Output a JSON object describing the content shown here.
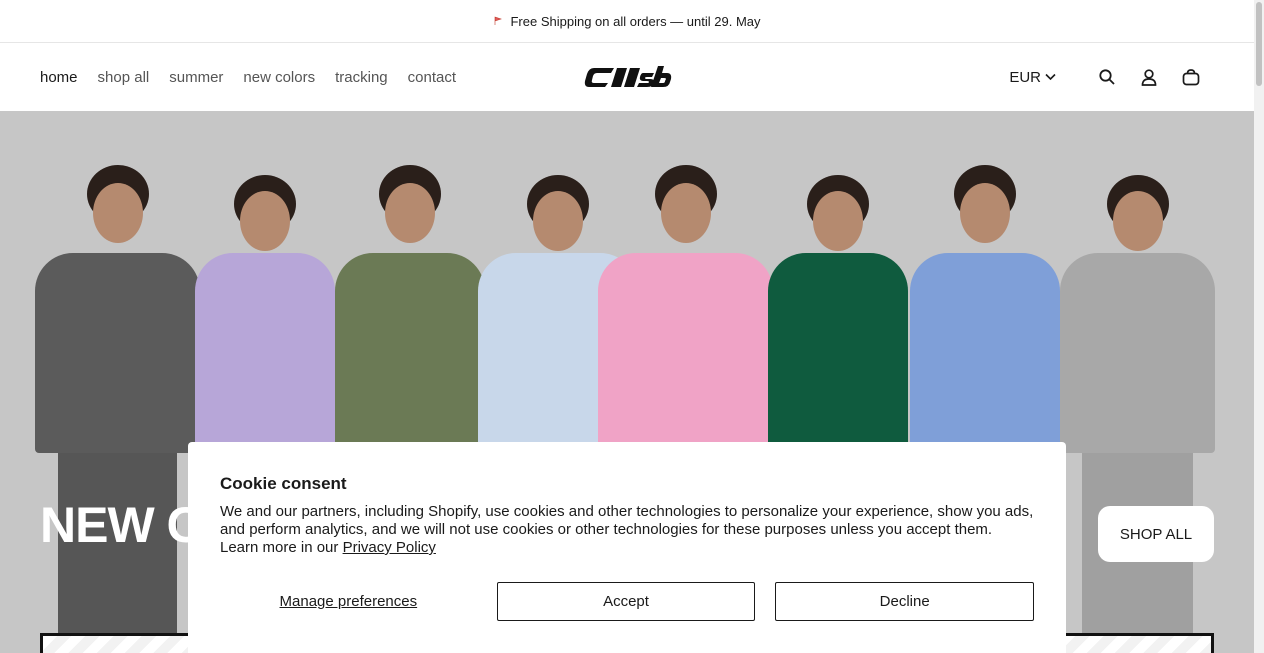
{
  "announcement": {
    "text": "Free Shipping on all orders — until 29. May",
    "icon": "flag-icon"
  },
  "nav": {
    "items": [
      {
        "label": "home",
        "active": true
      },
      {
        "label": "shop all"
      },
      {
        "label": "summer"
      },
      {
        "label": "new colors"
      },
      {
        "label": "tracking"
      },
      {
        "label": "contact"
      }
    ]
  },
  "header": {
    "currency": "EUR",
    "icons": [
      "search-icon",
      "account-icon",
      "cart-icon"
    ]
  },
  "hero": {
    "title": "NEW C",
    "cta_label": "SHOP ALL",
    "models": [
      {
        "outfit": "#5b5b5b"
      },
      {
        "outfit": "#b7a6d8"
      },
      {
        "outfit": "#6b7a55"
      },
      {
        "outfit": "#c8d7ea"
      },
      {
        "outfit": "#f0a3c6"
      },
      {
        "outfit": "#0f5b3e"
      },
      {
        "outfit": "#7f9fd8"
      },
      {
        "outfit": "#a8a8a8"
      }
    ]
  },
  "cookie": {
    "title": "Cookie consent",
    "body": "We and our partners, including Shopify, use cookies and other technologies to personalize your experience, show you ads, and perform analytics, and we will not use cookies or other technologies for these purposes unless you accept them. Learn more in our ",
    "privacy_link": "Privacy Policy",
    "manage_label": "Manage preferences",
    "accept_label": "Accept",
    "decline_label": "Decline"
  },
  "colors": {
    "text": "#1a1a1a",
    "hero_bg": "#c6c6c6",
    "announce_flag": "#e05a5a"
  }
}
